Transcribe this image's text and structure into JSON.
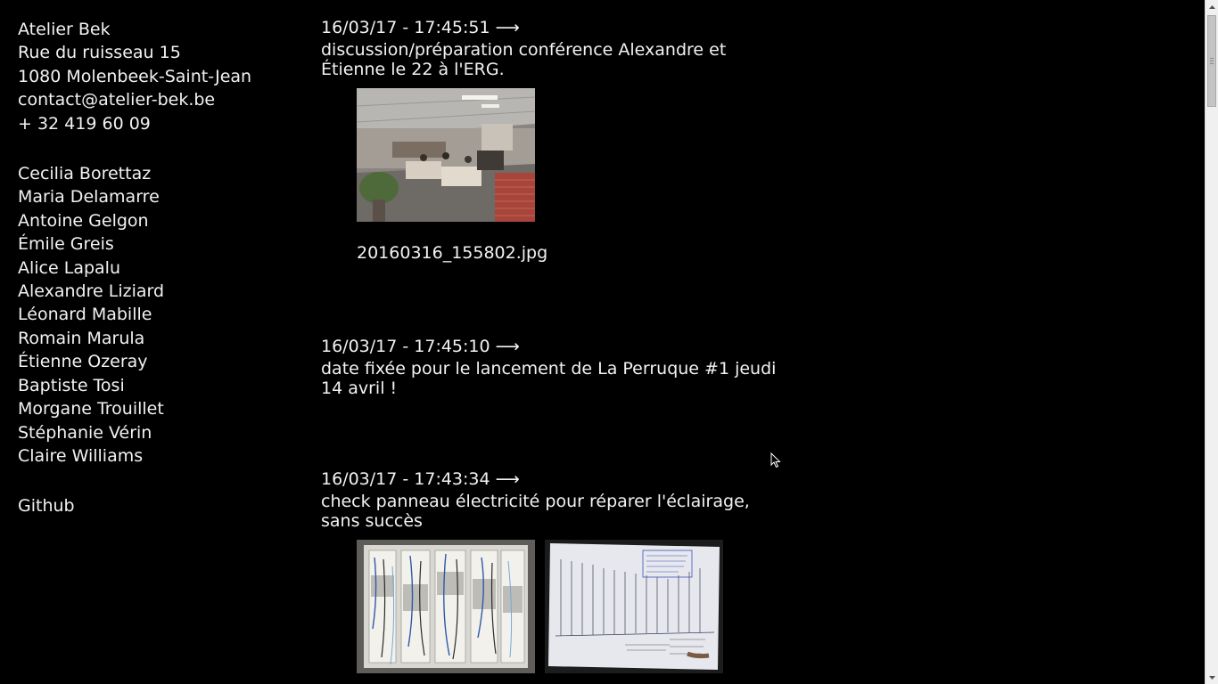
{
  "sidebar": {
    "studio": {
      "name": "Atelier Bek",
      "street": "Rue du ruisseau 15",
      "city": "1080 Molenbeek-Saint-Jean",
      "email": "contact@atelier-bek.be",
      "phone": "+ 32 419 60 09"
    },
    "members": [
      "Cecilia Borettaz",
      "Maria Delamarre",
      "Antoine Gelgon",
      "Émile Greis",
      "Alice Lapalu",
      "Alexandre Liziard",
      "Léonard Mabille",
      "Romain Marula",
      "Étienne Ozeray",
      "Baptiste Tosi",
      "Morgane Trouillet",
      "Stéphanie Vérin",
      "Claire Williams"
    ],
    "github_label": "Github"
  },
  "entries": [
    {
      "datetime": "16/03/17 - 17:45:51",
      "arrow": "⟶",
      "text": "discussion/préparation conférence Alexandre et Étienne le 22 à l'ERG.",
      "caption": "20160316_155802.jpg"
    },
    {
      "datetime": "16/03/17 - 17:45:10",
      "arrow": "⟶",
      "text": "date fixée pour le lancement de La Perruque #1 jeudi 14 avril !"
    },
    {
      "datetime": "16/03/17 - 17:43:34",
      "arrow": "⟶",
      "text": "check panneau électricité pour réparer l'éclairage, sans succès"
    }
  ],
  "icons": {
    "scroll_up": "triangle-up-icon",
    "scroll_down": "triangle-down-icon",
    "cursor": "mouse-pointer-icon"
  },
  "colors": {
    "background": "#000000",
    "text": "#f2f2f2",
    "scrollbar_track": "#f0f0f0",
    "scrollbar_thumb": "#c4c4c4"
  }
}
